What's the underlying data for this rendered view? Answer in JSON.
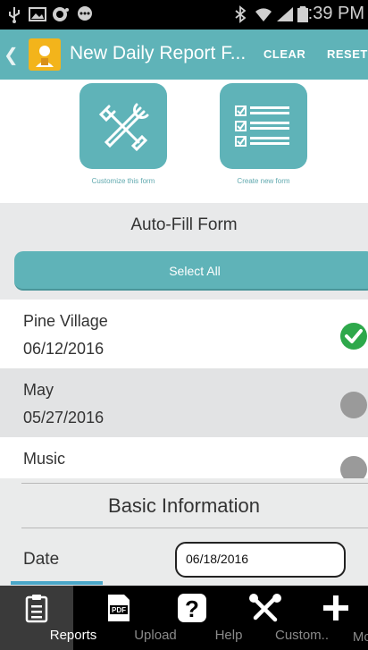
{
  "status_bar": {
    "time": "2:39 PM"
  },
  "app_bar": {
    "title": "New Daily Report F...",
    "clear_label": "CLEAR",
    "reset_label": "RESET",
    "accent_color": "#5fb3b8"
  },
  "tiles": [
    {
      "label": "Customize this form",
      "icon": "tools-icon"
    },
    {
      "label": "Create new form",
      "icon": "checklist-icon"
    }
  ],
  "autofill": {
    "title": "Auto-Fill Form",
    "select_all_label": "Select All"
  },
  "list": [
    {
      "name": "Pine Village",
      "date": "06/12/2016",
      "selected": true
    },
    {
      "name": "May",
      "date": "05/27/2016",
      "selected": false
    },
    {
      "name": "Music",
      "date": "",
      "selected": false
    }
  ],
  "basic_info": {
    "heading": "Basic Information",
    "date_label": "Date",
    "date_value": "06/18/2016"
  },
  "bottom_nav": [
    {
      "label": "Reports",
      "icon": "clipboard-icon",
      "active": true
    },
    {
      "label": "Upload",
      "icon": "pdf-icon",
      "active": false
    },
    {
      "label": "Help",
      "icon": "help-icon",
      "active": false
    },
    {
      "label": "Custom..",
      "icon": "tools-icon",
      "active": false
    },
    {
      "label": "More",
      "icon": "plus-icon",
      "active": false
    }
  ]
}
